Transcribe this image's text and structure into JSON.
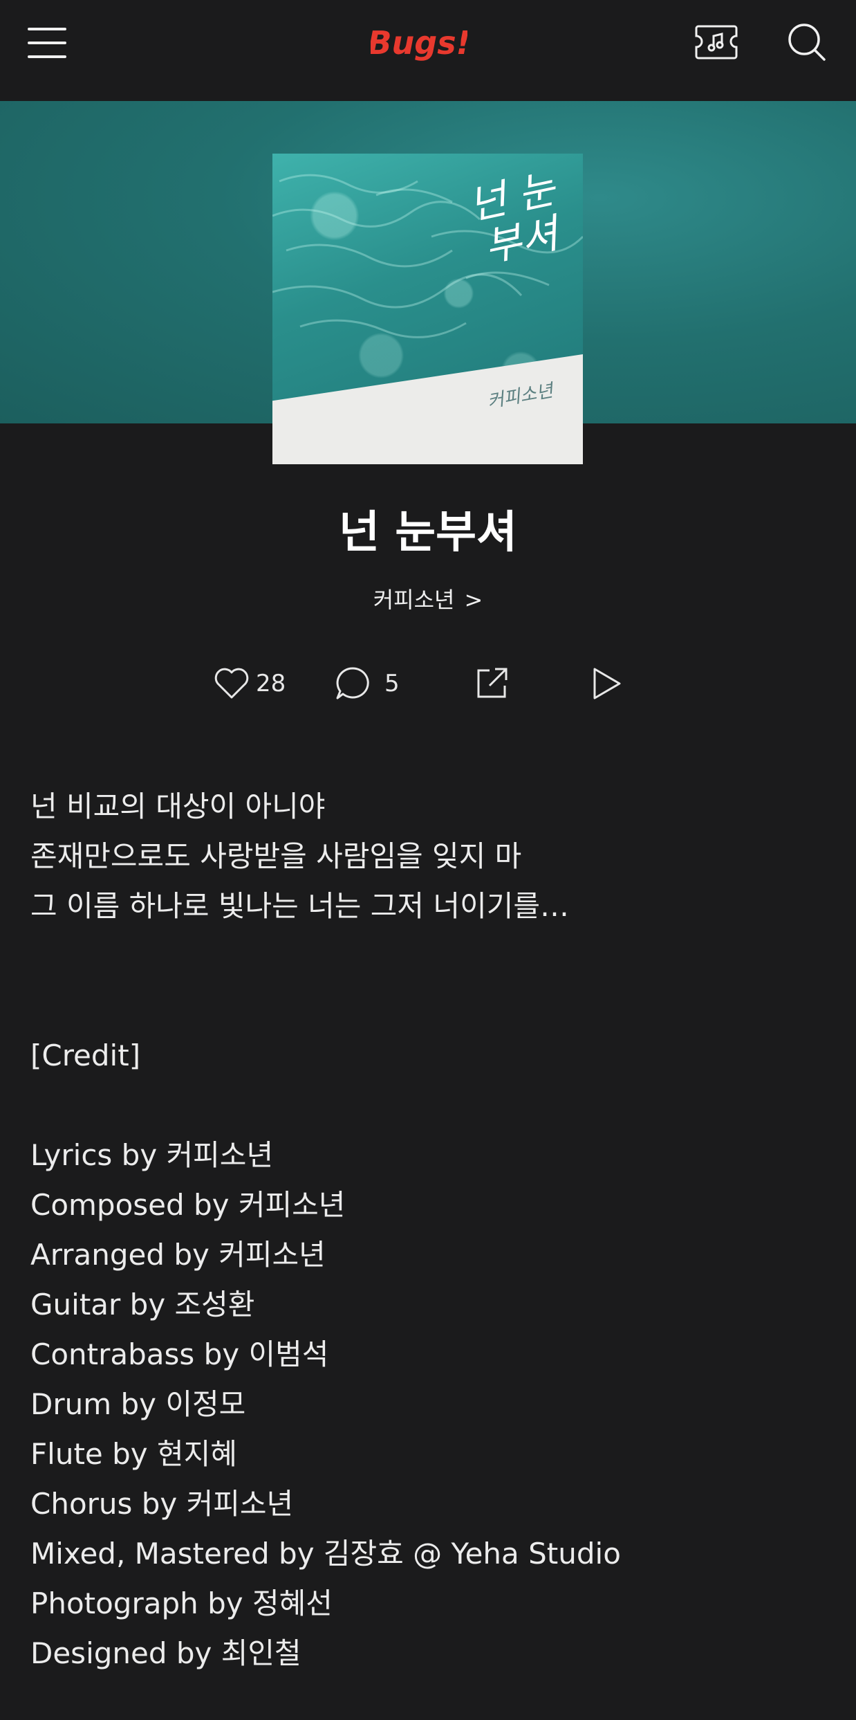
{
  "header": {
    "logo_text": "Bugs!",
    "logo_color": "#e8392e",
    "menu_icon": "hamburger-icon",
    "music_icon": "music-ticket-icon",
    "search_icon": "search-icon"
  },
  "album": {
    "cover_title": "넌 눈부셔",
    "cover_artist": "커피소년"
  },
  "song": {
    "title": "넌 눈부셔",
    "artist": "커피소년",
    "artist_chevron": ">"
  },
  "actions": {
    "likes": "28",
    "comments": "5"
  },
  "lyrics": [
    "넌 비교의 대상이 아니야",
    "존재만으로도 사랑받을 사람임을 잊지 마",
    "그 이름 하나로 빛나는 너는 그저 너이기를…"
  ],
  "credit_heading": "[Credit]",
  "credits": [
    "Lyrics by 커피소년",
    "Composed by 커피소년",
    "Arranged by 커피소년",
    "Guitar by 조성환",
    "Contrabass by 이범석",
    "Drum by 이정모",
    "Flute by 현지혜",
    "Chorus by 커피소년",
    "Mixed, Mastered by 김장효 @ Yeha Studio",
    "Photograph by 정혜선",
    "Designed by 최인철"
  ]
}
